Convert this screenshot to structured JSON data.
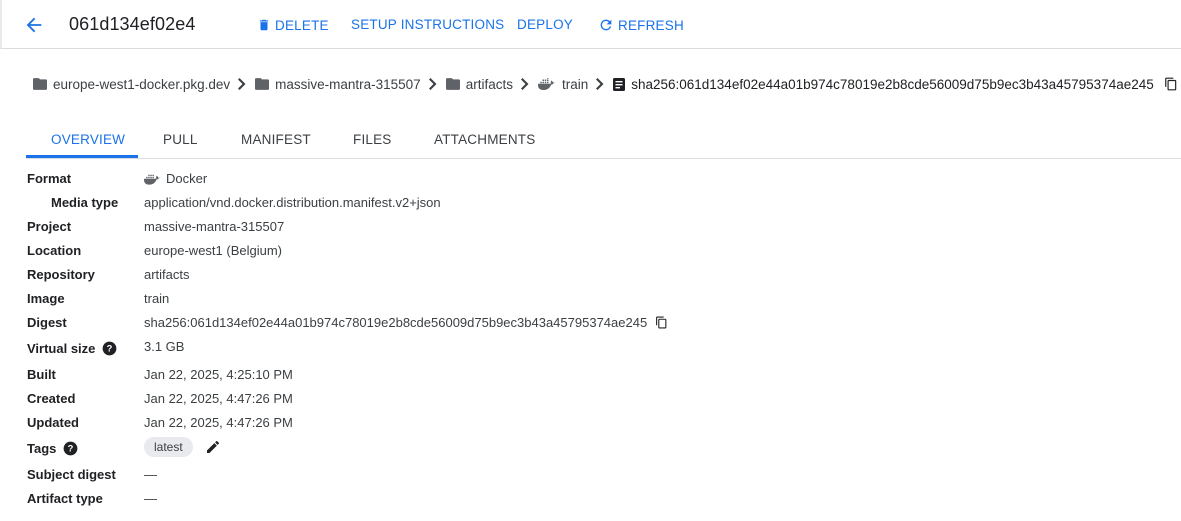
{
  "header": {
    "title": "061d134ef02e4",
    "actions": {
      "delete": "DELETE",
      "setup": "SETUP INSTRUCTIONS",
      "deploy": "DEPLOY",
      "refresh": "REFRESH"
    }
  },
  "breadcrumb": {
    "host": "europe-west1-docker.pkg.dev",
    "project": "massive-mantra-315507",
    "repository": "artifacts",
    "image": "train",
    "digest": "sha256:061d134ef02e44a01b974c78019e2b8cde56009d75b9ec3b43a45795374ae245"
  },
  "tabs": [
    "OVERVIEW",
    "PULL",
    "MANIFEST",
    "FILES",
    "ATTACHMENTS"
  ],
  "details": {
    "format_label": "Format",
    "format_value": "Docker",
    "media_type_label": "Media type",
    "media_type_value": "application/vnd.docker.distribution.manifest.v2+json",
    "project_label": "Project",
    "project_value": "massive-mantra-315507",
    "location_label": "Location",
    "location_value": "europe-west1 (Belgium)",
    "repository_label": "Repository",
    "repository_value": "artifacts",
    "image_label": "Image",
    "image_value": "train",
    "digest_label": "Digest",
    "digest_value": "sha256:061d134ef02e44a01b974c78019e2b8cde56009d75b9ec3b43a45795374ae245",
    "virtual_size_label": "Virtual size",
    "virtual_size_value": "3.1 GB",
    "built_label": "Built",
    "built_value": "Jan 22, 2025, 4:25:10 PM",
    "created_label": "Created",
    "created_value": "Jan 22, 2025, 4:47:26 PM",
    "updated_label": "Updated",
    "updated_value": "Jan 22, 2025, 4:47:26 PM",
    "tags_label": "Tags",
    "tag": "latest",
    "subject_digest_label": "Subject digest",
    "subject_digest_value": "—",
    "artifact_type_label": "Artifact type",
    "artifact_type_value": "—"
  },
  "colors": {
    "accent": "#1a73e8",
    "text": "#202124",
    "muted": "#3c4043",
    "divider": "#dadce0"
  },
  "icons": [
    "arrow-back-icon",
    "trash-icon",
    "refresh-icon",
    "folder-icon",
    "docker-icon",
    "document-icon",
    "copy-icon",
    "help-icon",
    "pencil-icon",
    "chevron-right-icon"
  ]
}
